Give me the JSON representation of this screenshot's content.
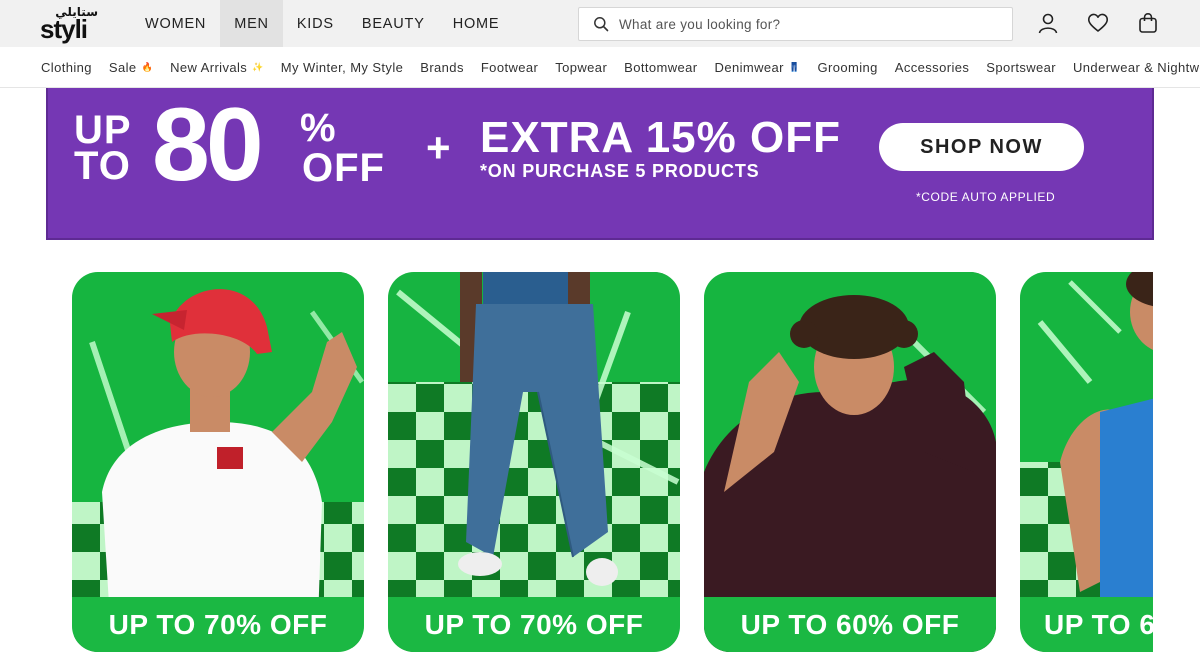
{
  "header": {
    "logo_arabic": "ستايلي",
    "logo_text": "styli",
    "nav": [
      {
        "label": "WOMEN",
        "active": false
      },
      {
        "label": "MEN",
        "active": true
      },
      {
        "label": "KIDS",
        "active": false
      },
      {
        "label": "BEAUTY",
        "active": false
      },
      {
        "label": "HOME",
        "active": false
      }
    ],
    "search_placeholder": "What are you looking for?",
    "icons": [
      "search-icon",
      "account-icon",
      "wishlist-heart-icon",
      "shopping-bag-icon"
    ]
  },
  "categories": [
    {
      "label": "Clothing",
      "emoji": ""
    },
    {
      "label": "Sale",
      "emoji": "🔥"
    },
    {
      "label": "New Arrivals",
      "emoji": "✨"
    },
    {
      "label": "My Winter, My Style",
      "emoji": ""
    },
    {
      "label": "Brands",
      "emoji": ""
    },
    {
      "label": "Footwear",
      "emoji": ""
    },
    {
      "label": "Topwear",
      "emoji": ""
    },
    {
      "label": "Bottomwear",
      "emoji": ""
    },
    {
      "label": "Denimwear",
      "emoji": "👖"
    },
    {
      "label": "Grooming",
      "emoji": ""
    },
    {
      "label": "Accessories",
      "emoji": ""
    },
    {
      "label": "Sportswear",
      "emoji": ""
    },
    {
      "label": "Underwear & Nightwe",
      "emoji": ""
    }
  ],
  "banner": {
    "up_to": "UP\nTO",
    "percent_value": "80",
    "percent_sign": "%",
    "off": "OFF",
    "plus": "+",
    "extra": "EXTRA 15% OFF",
    "purchase_note": "*ON PURCHASE 5 PRODUCTS",
    "cta": "SHOP NOW",
    "code_note": "*CODE AUTO APPLIED",
    "colors": {
      "background": "#7537b4",
      "text": "#ffffff"
    }
  },
  "cards": [
    {
      "label": "UP TO 70% OFF",
      "subject": "white t-shirt with red cap"
    },
    {
      "label": "UP TO 70% OFF",
      "subject": "blue baggy jeans"
    },
    {
      "label": "UP TO 60% OFF",
      "subject": "dark maroon hoodie"
    },
    {
      "label": "UP TO 6",
      "subject": "blue tank top"
    }
  ],
  "colors": {
    "card_green": "#1bb843",
    "topbar_bg": "#f1f1f1",
    "active_nav_bg": "#e2e2e2"
  }
}
